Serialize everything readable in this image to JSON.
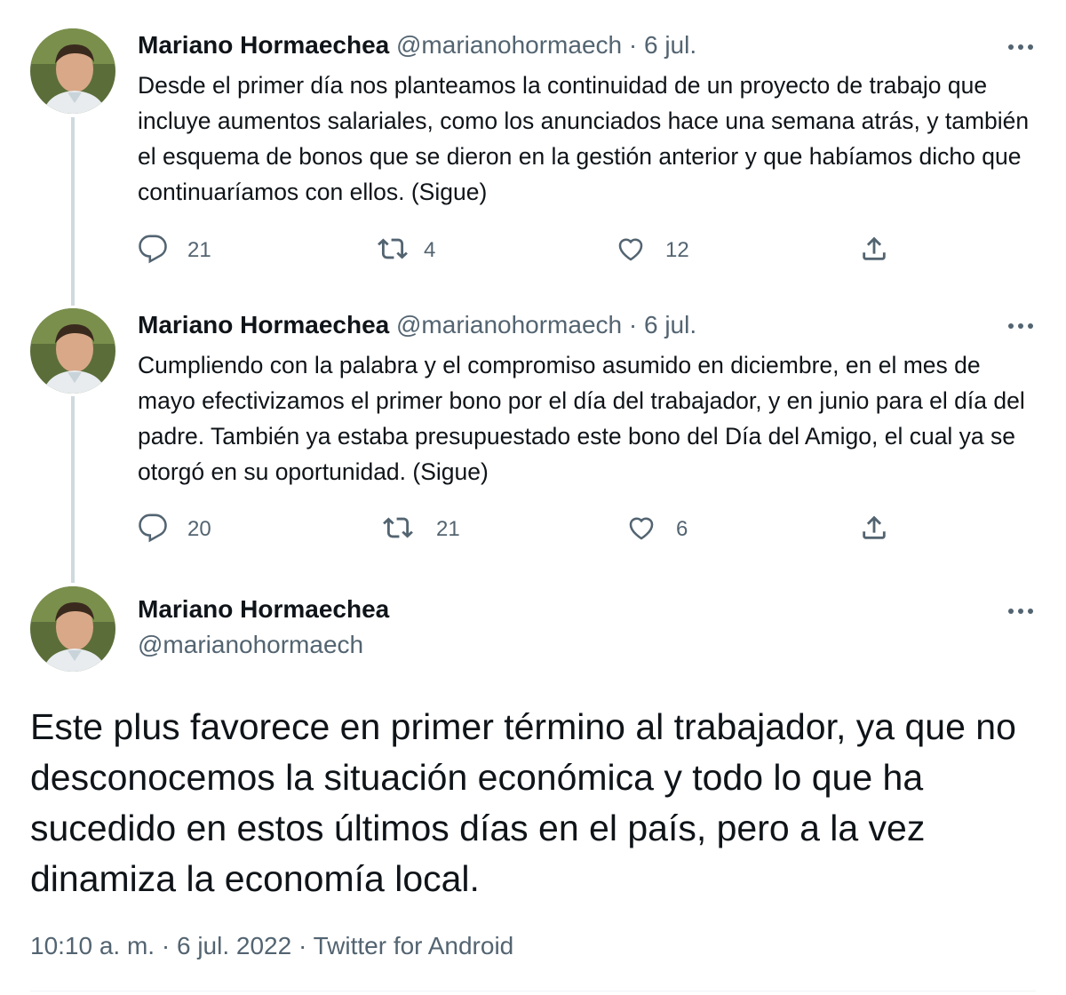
{
  "author": {
    "name": "Mariano Hormaechea",
    "handle": "@marianohormaech"
  },
  "separator": "·",
  "thread": [
    {
      "date": "6 jul.",
      "text": "Desde el primer día nos planteamos la continuidad de un proyecto de trabajo que incluye aumentos salariales, como los anunciados hace una semana atrás, y también el esquema de bonos que se dieron en la gestión anterior y que habíamos dicho que continuaríamos con ellos. (Sigue)",
      "replies": "21",
      "retweets": "4",
      "likes": "12"
    },
    {
      "date": "6 jul.",
      "text": "Cumpliendo con la palabra y el compromiso asumido en diciembre, en el mes de mayo efectivizamos el primer bono por el día del trabajador, y en junio para el día del padre. También ya estaba presupuestado este bono del Día del Amigo, el cual ya se otorgó en su oportunidad. (Sigue)",
      "replies": "20",
      "retweets": "21",
      "likes": "6"
    }
  ],
  "main_tweet": {
    "text": "Este plus favorece en primer término al trabajador, ya que no desconocemos la situación económica y todo lo que ha sucedido en estos últimos días en el país, pero a la vez dinamiza la economía local.",
    "time": "10:10 a. m.",
    "date": "6 jul. 2022",
    "source": "Twitter for Android"
  },
  "icons": {
    "reply": "reply-icon",
    "retweet": "retweet-icon",
    "like": "heart-icon",
    "share": "share-icon",
    "more": "more-icon",
    "avatar": "profile-photo"
  },
  "colors": {
    "text": "#0f1419",
    "secondary": "#536471",
    "thread_line": "#cfd9de"
  }
}
